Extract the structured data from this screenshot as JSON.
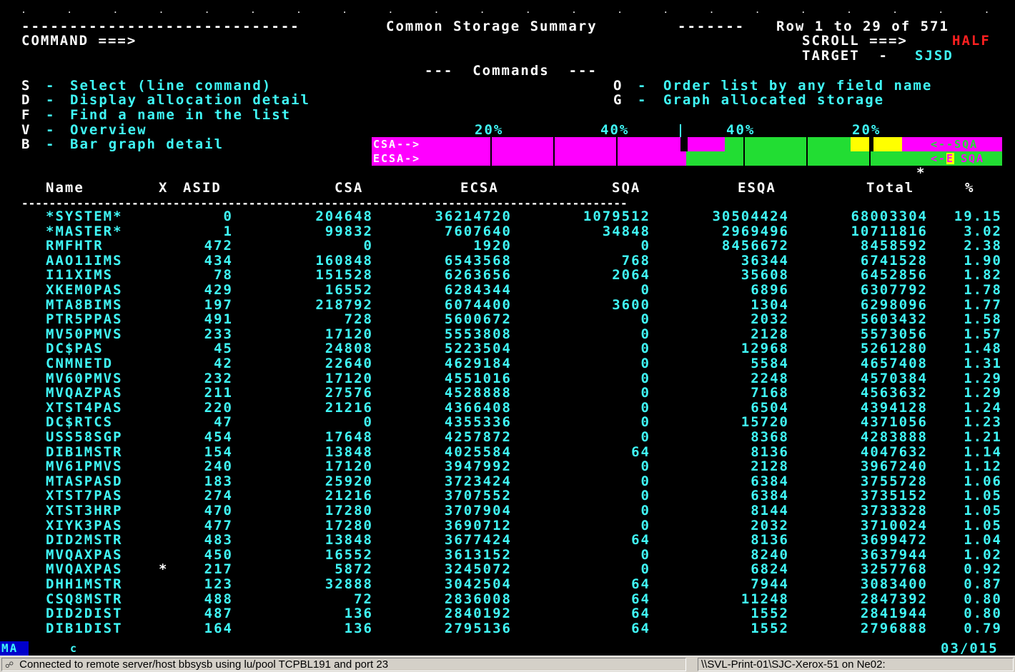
{
  "screen": {
    "dashes_left": "-----------------------------",
    "title": "Common Storage Summary",
    "dashes_mid": "-------",
    "row_info": "Row 1 to 29 of 571",
    "command_label": "COMMAND ===>",
    "scroll_label": "SCROLL ===>",
    "scroll_value": "HALF",
    "target_label": "TARGET  -",
    "target_value": "SJSD"
  },
  "commands": {
    "header": "---  Commands  ---",
    "items": [
      {
        "key": "S",
        "sep": "-",
        "text": "Select (line command)"
      },
      {
        "key": "D",
        "sep": "-",
        "text": "Display allocation detail"
      },
      {
        "key": "F",
        "sep": "-",
        "text": "Find a name in the list"
      },
      {
        "key": "V",
        "sep": "-",
        "text": "Overview"
      },
      {
        "key": "B",
        "sep": "-",
        "text": "Bar graph detail"
      },
      {
        "key": "O",
        "sep": "-",
        "text": "Order list by any field name"
      },
      {
        "key": "G",
        "sep": "-",
        "text": "Graph allocated storage"
      }
    ]
  },
  "bar_graph": {
    "scale_labels": [
      "20%",
      "40%",
      "40%",
      "20%"
    ],
    "row1_left_label": "CSA-->",
    "row1_right_label": "<--SQA",
    "row2_left_label": "ECSA->",
    "row2_right_prefix": "<-",
    "row2_right_highlight": "E",
    "row2_right_suffix": "SQA",
    "marker": "*",
    "colors": {
      "csa": "#ff00ff",
      "sqa": "#22dd33",
      "esqa_marker": "#ffff00"
    }
  },
  "table": {
    "headers": [
      "Name",
      "X",
      "ASID",
      "CSA",
      "ECSA",
      "SQA",
      "ESQA",
      "Total",
      "%"
    ],
    "separator": "----------------------------------------------------------------------------------------",
    "rows": [
      {
        "name": "*SYSTEM*",
        "x": "",
        "asid": "0",
        "csa": "204648",
        "ecsa": "36214720",
        "sqa": "1079512",
        "esqa": "30504424",
        "total": "68003304",
        "pct": "19.15"
      },
      {
        "name": "*MASTER*",
        "x": "",
        "asid": "1",
        "csa": "99832",
        "ecsa": "7607640",
        "sqa": "34848",
        "esqa": "2969496",
        "total": "10711816",
        "pct": "3.02"
      },
      {
        "name": "RMFHTR",
        "x": "",
        "asid": "472",
        "csa": "0",
        "ecsa": "1920",
        "sqa": "0",
        "esqa": "8456672",
        "total": "8458592",
        "pct": "2.38"
      },
      {
        "name": "AAO11IMS",
        "x": "",
        "asid": "434",
        "csa": "160848",
        "ecsa": "6543568",
        "sqa": "768",
        "esqa": "36344",
        "total": "6741528",
        "pct": "1.90"
      },
      {
        "name": "I11XIMS",
        "x": "",
        "asid": "78",
        "csa": "151528",
        "ecsa": "6263656",
        "sqa": "2064",
        "esqa": "35608",
        "total": "6452856",
        "pct": "1.82"
      },
      {
        "name": "XKEM0PAS",
        "x": "",
        "asid": "429",
        "csa": "16552",
        "ecsa": "6284344",
        "sqa": "0",
        "esqa": "6896",
        "total": "6307792",
        "pct": "1.78"
      },
      {
        "name": "MTA8BIMS",
        "x": "",
        "asid": "197",
        "csa": "218792",
        "ecsa": "6074400",
        "sqa": "3600",
        "esqa": "1304",
        "total": "6298096",
        "pct": "1.77"
      },
      {
        "name": "PTR5PPAS",
        "x": "",
        "asid": "491",
        "csa": "728",
        "ecsa": "5600672",
        "sqa": "0",
        "esqa": "2032",
        "total": "5603432",
        "pct": "1.58"
      },
      {
        "name": "MV50PMVS",
        "x": "",
        "asid": "233",
        "csa": "17120",
        "ecsa": "5553808",
        "sqa": "0",
        "esqa": "2128",
        "total": "5573056",
        "pct": "1.57"
      },
      {
        "name": "DC$PAS",
        "x": "",
        "asid": "45",
        "csa": "24808",
        "ecsa": "5223504",
        "sqa": "0",
        "esqa": "12968",
        "total": "5261280",
        "pct": "1.48"
      },
      {
        "name": "CNMNETD",
        "x": "",
        "asid": "42",
        "csa": "22640",
        "ecsa": "4629184",
        "sqa": "0",
        "esqa": "5584",
        "total": "4657408",
        "pct": "1.31"
      },
      {
        "name": "MV60PMVS",
        "x": "",
        "asid": "232",
        "csa": "17120",
        "ecsa": "4551016",
        "sqa": "0",
        "esqa": "2248",
        "total": "4570384",
        "pct": "1.29"
      },
      {
        "name": "MVQAZPAS",
        "x": "",
        "asid": "211",
        "csa": "27576",
        "ecsa": "4528888",
        "sqa": "0",
        "esqa": "7168",
        "total": "4563632",
        "pct": "1.29"
      },
      {
        "name": "XTST4PAS",
        "x": "",
        "asid": "220",
        "csa": "21216",
        "ecsa": "4366408",
        "sqa": "0",
        "esqa": "6504",
        "total": "4394128",
        "pct": "1.24"
      },
      {
        "name": "DC$RTCS",
        "x": "",
        "asid": "47",
        "csa": "0",
        "ecsa": "4355336",
        "sqa": "0",
        "esqa": "15720",
        "total": "4371056",
        "pct": "1.23"
      },
      {
        "name": "USS58SGP",
        "x": "",
        "asid": "454",
        "csa": "17648",
        "ecsa": "4257872",
        "sqa": "0",
        "esqa": "8368",
        "total": "4283888",
        "pct": "1.21"
      },
      {
        "name": "DIB1MSTR",
        "x": "",
        "asid": "154",
        "csa": "13848",
        "ecsa": "4025584",
        "sqa": "64",
        "esqa": "8136",
        "total": "4047632",
        "pct": "1.14"
      },
      {
        "name": "MV61PMVS",
        "x": "",
        "asid": "240",
        "csa": "17120",
        "ecsa": "3947992",
        "sqa": "0",
        "esqa": "2128",
        "total": "3967240",
        "pct": "1.12"
      },
      {
        "name": "MTASPASD",
        "x": "",
        "asid": "183",
        "csa": "25920",
        "ecsa": "3723424",
        "sqa": "0",
        "esqa": "6384",
        "total": "3755728",
        "pct": "1.06"
      },
      {
        "name": "XTST7PAS",
        "x": "",
        "asid": "274",
        "csa": "21216",
        "ecsa": "3707552",
        "sqa": "0",
        "esqa": "6384",
        "total": "3735152",
        "pct": "1.05"
      },
      {
        "name": "XTST3HRP",
        "x": "",
        "asid": "470",
        "csa": "17280",
        "ecsa": "3707904",
        "sqa": "0",
        "esqa": "8144",
        "total": "3733328",
        "pct": "1.05"
      },
      {
        "name": "XIYK3PAS",
        "x": "",
        "asid": "477",
        "csa": "17280",
        "ecsa": "3690712",
        "sqa": "0",
        "esqa": "2032",
        "total": "3710024",
        "pct": "1.05"
      },
      {
        "name": "DID2MSTR",
        "x": "",
        "asid": "483",
        "csa": "13848",
        "ecsa": "3677424",
        "sqa": "64",
        "esqa": "8136",
        "total": "3699472",
        "pct": "1.04"
      },
      {
        "name": "MVQAXPAS",
        "x": "",
        "asid": "450",
        "csa": "16552",
        "ecsa": "3613152",
        "sqa": "0",
        "esqa": "8240",
        "total": "3637944",
        "pct": "1.02"
      },
      {
        "name": "MVQAXPAS",
        "x": "*",
        "asid": "217",
        "csa": "5872",
        "ecsa": "3245072",
        "sqa": "0",
        "esqa": "6824",
        "total": "3257768",
        "pct": "0.92"
      },
      {
        "name": "DHH1MSTR",
        "x": "",
        "asid": "123",
        "csa": "32888",
        "ecsa": "3042504",
        "sqa": "64",
        "esqa": "7944",
        "total": "3083400",
        "pct": "0.87"
      },
      {
        "name": "CSQ8MSTR",
        "x": "",
        "asid": "488",
        "csa": "72",
        "ecsa": "2836008",
        "sqa": "64",
        "esqa": "11248",
        "total": "2847392",
        "pct": "0.80"
      },
      {
        "name": "DID2DIST",
        "x": "",
        "asid": "487",
        "csa": "136",
        "ecsa": "2840192",
        "sqa": "64",
        "esqa": "1552",
        "total": "2841944",
        "pct": "0.80"
      },
      {
        "name": "DIB1DIST",
        "x": "",
        "asid": "164",
        "csa": "136",
        "ecsa": "2795136",
        "sqa": "64",
        "esqa": "1552",
        "total": "2796888",
        "pct": "0.79"
      }
    ]
  },
  "oia": {
    "session_indicator": "MA",
    "field_marker": "c",
    "cursor_position": "03/015"
  },
  "status_bar": {
    "connection_text": "Connected to remote server/host bbsysb using lu/pool TCPBL191 and port 23",
    "printer_text": "\\\\SVL-Print-01\\SJC-Xerox-51 on Ne02:"
  }
}
